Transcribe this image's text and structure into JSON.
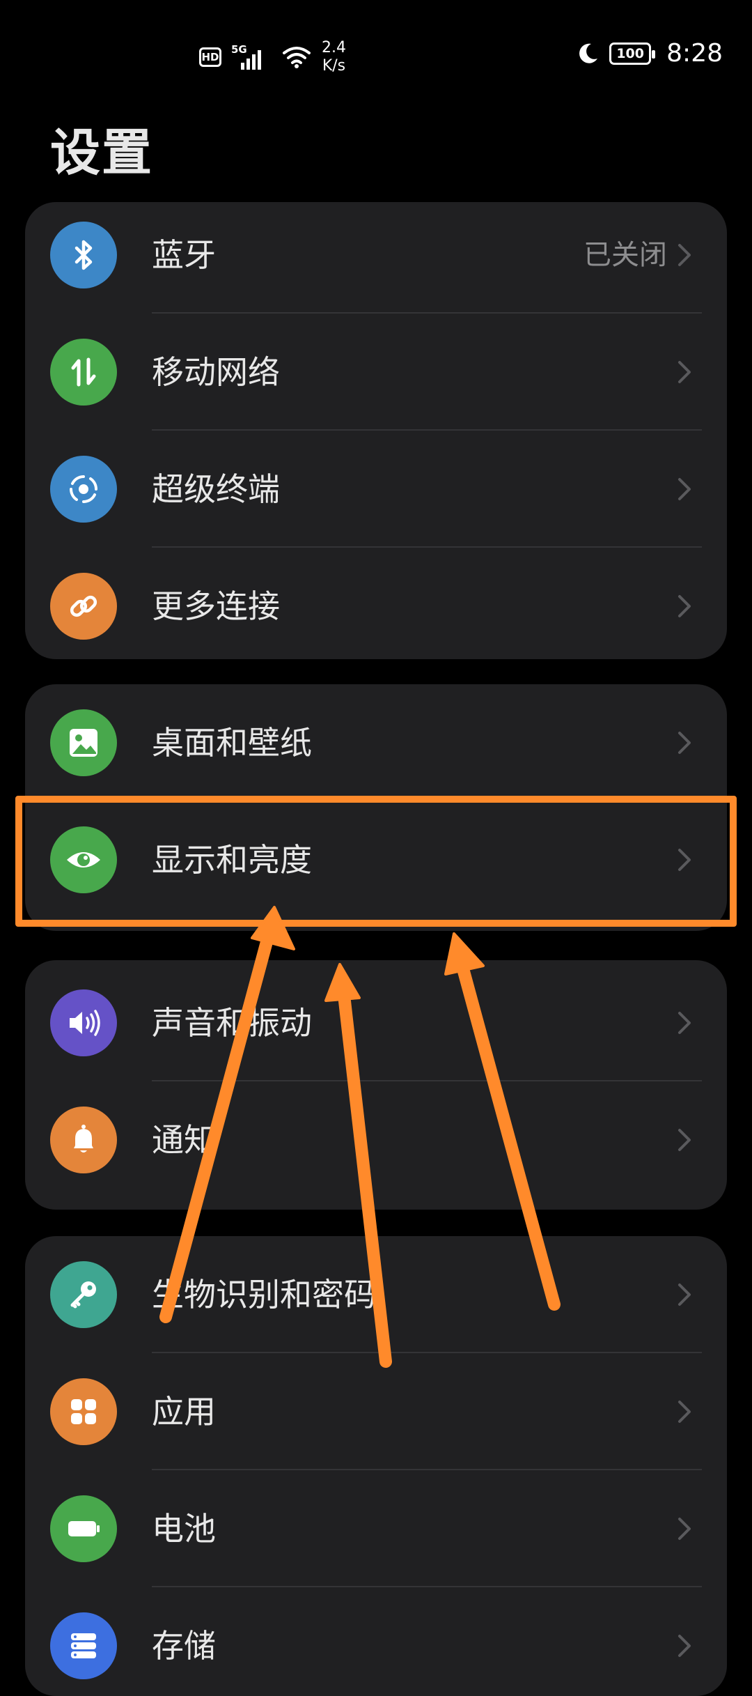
{
  "status_bar": {
    "hd": "HD",
    "network_type": "5G",
    "net_speed_value": "2.4",
    "net_speed_unit": "K/s",
    "battery": "100",
    "time": "8:28"
  },
  "page_title": "设置",
  "groups": [
    {
      "items": [
        {
          "label": "蓝牙",
          "value": "已关闭",
          "icon": "bluetooth-icon",
          "color": "#3d87c7"
        },
        {
          "label": "移动网络",
          "icon": "mobile-data-icon",
          "color": "#48a84c"
        },
        {
          "label": "超级终端",
          "icon": "super-device-icon",
          "color": "#3d87c7"
        },
        {
          "label": "更多连接",
          "icon": "link-icon",
          "color": "#e4853a"
        }
      ]
    },
    {
      "items": [
        {
          "label": "桌面和壁纸",
          "icon": "wallpaper-icon",
          "color": "#48a84c"
        },
        {
          "label": "显示和亮度",
          "icon": "eye-icon",
          "color": "#48a84c"
        }
      ]
    },
    {
      "items": [
        {
          "label": "声音和振动",
          "icon": "speaker-icon",
          "color": "#6552c7"
        },
        {
          "label": "通知",
          "icon": "bell-icon",
          "color": "#e4853a"
        }
      ]
    },
    {
      "items": [
        {
          "label": "生物识别和密码",
          "icon": "key-icon",
          "color": "#3fa691"
        },
        {
          "label": "应用",
          "icon": "apps-icon",
          "color": "#e4853a"
        },
        {
          "label": "电池",
          "icon": "battery-icon",
          "color": "#48a84c"
        },
        {
          "label": "存储",
          "icon": "storage-icon",
          "color": "#3d6fe0"
        }
      ]
    }
  ],
  "annotation": {
    "color": "#ff8a2b"
  }
}
